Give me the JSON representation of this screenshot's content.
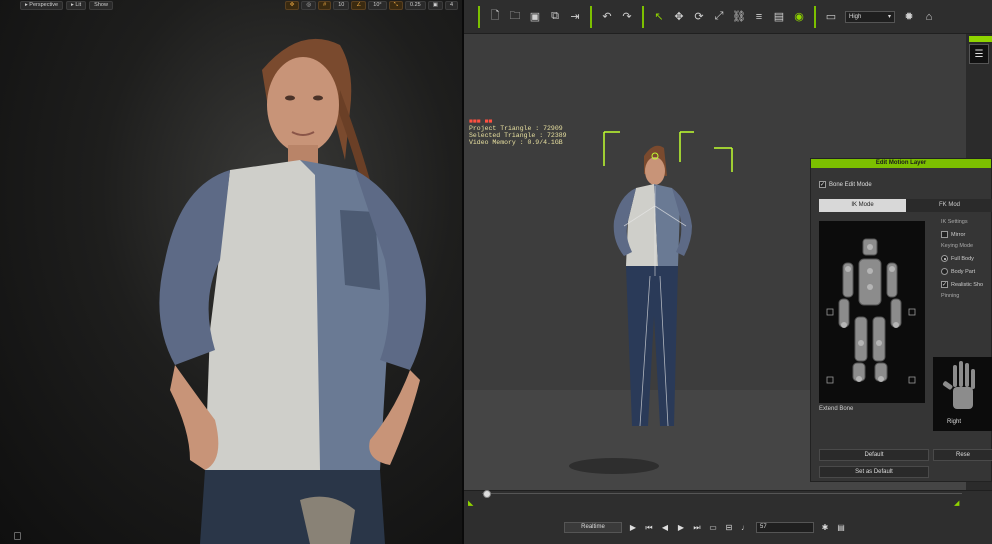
{
  "left_viewport": {
    "toolbar": {
      "perspective_label": "Perspective",
      "lit_label": "Lit",
      "show_label": "Show",
      "grid_snap": "10",
      "rotation_snap": "10°",
      "scale_snap": "0.25",
      "camera_speed": "4"
    }
  },
  "iclone": {
    "toolbar": {
      "quality_value": "High",
      "icons": [
        "new-file-icon",
        "open-folder-icon",
        "save-icon",
        "export-icon",
        "import-icon",
        "undo-icon",
        "redo-icon",
        "select-icon",
        "move-icon",
        "rotate-icon",
        "scale-icon",
        "link-icon",
        "align-icon",
        "visibility-icon",
        "screen-icon",
        "sun-icon",
        "home-icon"
      ]
    },
    "stats": {
      "project_triangle": "Project Triangle : 72909",
      "selected_triangle": "Selected Triangle : 72389",
      "video_memory": "Video Memory : 0.9/4.1GB"
    },
    "edit_motion_layer": {
      "title": "Edit Motion Layer",
      "bone_edit_mode": "Bone Edit Mode",
      "tabs": [
        {
          "label": "IK Mode",
          "active": true
        },
        {
          "label": "FK Mod",
          "active": false
        }
      ],
      "ik_settings_label": "IK Settings",
      "mirror_label": "Mirror",
      "keying_mode_label": "Keying Mode",
      "full_body_label": "Full Body",
      "body_part_label": "Body Part",
      "realistic_label": "Realistic Sho",
      "pinning_label": "Pinning",
      "extend_bone_label": "Extend Bone",
      "hand_label": "Right",
      "default_button": "Default",
      "reset_button": "Rese",
      "set_as_default_button": "Set as Default"
    },
    "timeline": {
      "realtime_label": "Realtime",
      "frame_value": "57"
    }
  }
}
